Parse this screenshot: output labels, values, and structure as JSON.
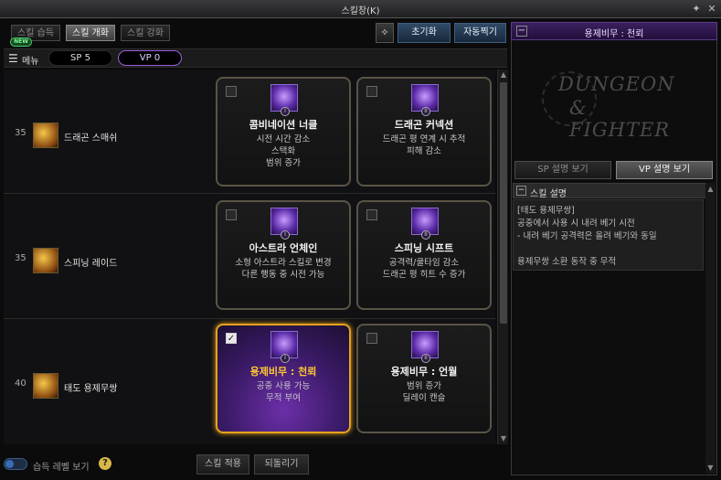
{
  "window": {
    "title": "스킬창(K)",
    "pin_icon": "pin-icon",
    "close_icon": "close-icon"
  },
  "tabs": [
    {
      "label": "스킬 습득",
      "active": false
    },
    {
      "label": "스킬 개화",
      "active": true
    },
    {
      "label": "스킬 강화",
      "active": false
    }
  ],
  "new_badge": "NEW",
  "toolbar": {
    "settings_icon": "sparkle-settings-icon",
    "reset_label": "초기화",
    "auto_label": "자동찍기"
  },
  "subbar": {
    "menu_label": "메뉴",
    "sp": "SP 5",
    "vp": "VP 0"
  },
  "skills": [
    {
      "level": "35",
      "name": "드래곤 스매쉬",
      "options": [
        {
          "roman": "I",
          "title": "콤비네이션 너클",
          "lines": [
            "시전 시간 감소",
            "스택화",
            "범위 증가"
          ],
          "selected": false
        },
        {
          "roman": "II",
          "title": "드래곤 커넥션",
          "lines": [
            "드래곤 평 연계 시 추적",
            "피해 감소"
          ],
          "selected": false
        }
      ]
    },
    {
      "level": "35",
      "name": "스피닝 레이드",
      "options": [
        {
          "roman": "I",
          "title": "아스트라 언체인",
          "lines": [
            "소형 아스트라 스킬로 변경",
            "다른 행동 중 시전 가능"
          ],
          "selected": false
        },
        {
          "roman": "II",
          "title": "스피닝 시프트",
          "lines": [
            "공격력/쿨타임 감소",
            "드래곤 평 히트 수 증가"
          ],
          "selected": false
        }
      ]
    },
    {
      "level": "40",
      "name": "태도 용제무쌍",
      "options": [
        {
          "roman": "I",
          "title": "용제비무 : 천뢰",
          "lines": [
            "공중 사용 가능",
            "무적 부여"
          ],
          "selected": true
        },
        {
          "roman": "II",
          "title": "용제비무 : 언월",
          "lines": [
            "범위 증가",
            "딜레이 캔슬"
          ],
          "selected": false
        }
      ]
    }
  ],
  "footer": {
    "toggle_label": "습득 레벨 보기",
    "help": "?",
    "apply_label": "스킬 적용",
    "revert_label": "되돌리기"
  },
  "right_panel": {
    "header": "용제비무 : 천뢰",
    "logo_line1": "DUNGEON",
    "logo_line2": "& FIGHTER",
    "tab_sp": "SP 설명 보기",
    "tab_vp": "VP 설명 보기",
    "desc_title": "스킬 설명",
    "desc_lines": [
      "[태도 용제무쌍]",
      "공중에서 사용 시 내려 베기 시전",
      "- 내려 베기 공격력은 올려 베기와 동일",
      "",
      "용제무쌍 소환 동작 중 무적"
    ]
  },
  "colors": {
    "accent_gold": "#e6a21c",
    "vp_purple": "#9a5ee0",
    "button_blue": "#304a66"
  }
}
